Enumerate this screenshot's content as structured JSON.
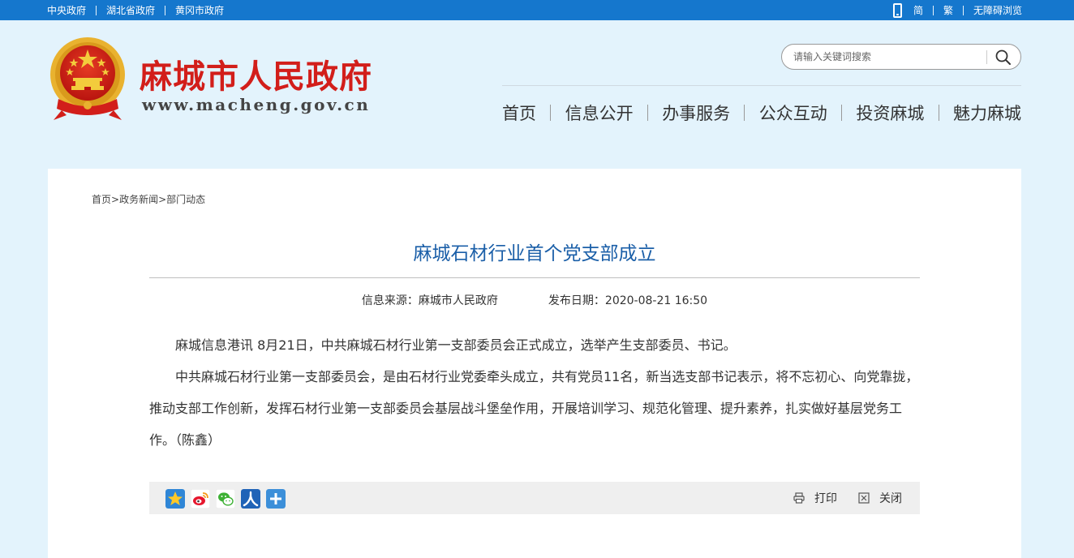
{
  "topbar": {
    "links": [
      "中央政府",
      "湖北省政府",
      "黄冈市政府"
    ],
    "right_links": [
      "简",
      "繁",
      "无障碍浏览"
    ]
  },
  "header": {
    "site_title": "麻城市人民政府",
    "site_url": "www.macheng.gov.cn",
    "search": {
      "placeholder": "请输入关键词搜索",
      "value": ""
    },
    "nav": [
      "首页",
      "信息公开",
      "办事服务",
      "公众互动",
      "投资麻城",
      "魅力麻城"
    ]
  },
  "breadcrumb": [
    "首页",
    "政务新闻",
    "部门动态"
  ],
  "article": {
    "title": "麻城石材行业首个党支部成立",
    "source_label": "信息来源：麻城市人民政府",
    "date_label": "发布日期：2020-08-21 16:50",
    "paragraphs": [
      "麻城信息港讯  8月21日，中共麻城石材行业第一支部委员会正式成立，选举产生支部委员、书记。",
      "中共麻城石材行业第一支部委员会，是由石材行业党委牵头成立，共有党员11名，新当选支部书记表示，将不忘初心、向党靠拢，推动支部工作创新，发挥石材行业第一支部委员会基层战斗堡垒作用，开展培训学习、规范化管理、提升素养，扎实做好基层党务工作。（陈鑫）"
    ]
  },
  "share": {
    "icons": [
      "qzone-icon",
      "weibo-icon",
      "wechat-icon",
      "renren-icon",
      "more-share-icon"
    ],
    "print_label": "打印",
    "close_label": "关闭"
  },
  "colors": {
    "topbar": "#1577cd",
    "page_bg": "#e3f3fc",
    "title_red": "#d21e1a",
    "article_title_blue": "#1b5fa8"
  }
}
